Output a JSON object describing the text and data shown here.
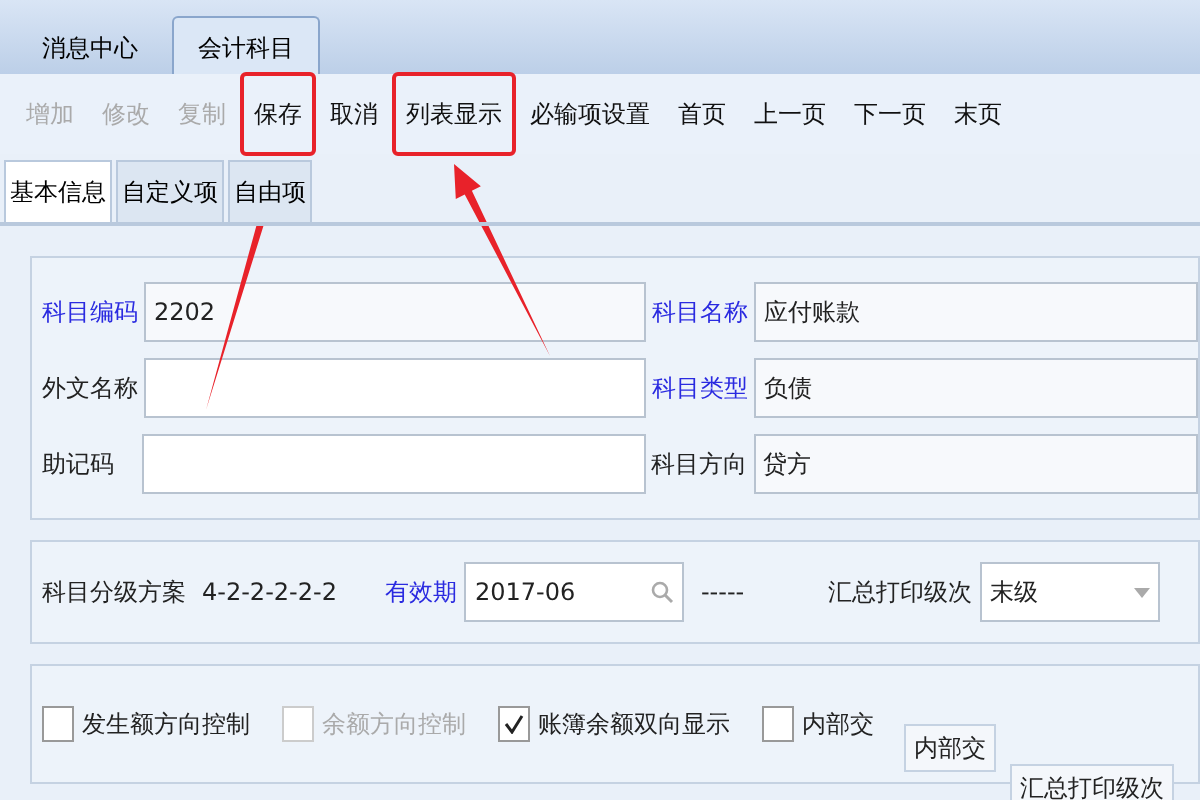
{
  "tabs": [
    {
      "label": "消息中心",
      "selected": false
    },
    {
      "label": "会计科目",
      "selected": true
    }
  ],
  "toolbar": [
    {
      "label": "增加",
      "disabled": true,
      "highlighted": false
    },
    {
      "label": "修改",
      "disabled": true,
      "highlighted": false
    },
    {
      "label": "复制",
      "disabled": true,
      "highlighted": false
    },
    {
      "label": "保存",
      "disabled": false,
      "highlighted": true
    },
    {
      "label": "取消",
      "disabled": false,
      "highlighted": false
    },
    {
      "label": "列表显示",
      "disabled": false,
      "highlighted": true
    },
    {
      "label": "必输项设置",
      "disabled": false,
      "highlighted": false
    },
    {
      "label": "首页",
      "disabled": false,
      "highlighted": false
    },
    {
      "label": "上一页",
      "disabled": false,
      "highlighted": false
    },
    {
      "label": "下一页",
      "disabled": false,
      "highlighted": false
    },
    {
      "label": "末页",
      "disabled": false,
      "highlighted": false
    }
  ],
  "subtabs": [
    {
      "label": "基本信息",
      "selected": true
    },
    {
      "label": "自定义项",
      "selected": false
    },
    {
      "label": "自由项",
      "selected": false
    }
  ],
  "fields": [
    {
      "label": "科目编码",
      "required": true,
      "value": "2202"
    },
    {
      "label": "科目名称",
      "required": true,
      "value": "应付账款"
    },
    {
      "label": "外文名称",
      "required": false
    },
    {
      "label": "科目类型",
      "required": true,
      "value": "负债"
    },
    {
      "label": "助记码",
      "required": false
    },
    {
      "label": "科目方向",
      "required": false,
      "value": "贷方"
    }
  ],
  "scheme": {
    "label": "科目分级方案",
    "value": "4-2-2-2-2-2"
  },
  "valid_period": {
    "label": "有效期",
    "value": "2017-06",
    "separator": "-----"
  },
  "print_level": {
    "label": "汇总打印级次",
    "value": "末级"
  },
  "checkboxes": [
    {
      "label": "发生额方向控制",
      "checked": false,
      "disabled": false
    },
    {
      "label": "余额方向控制",
      "checked": false,
      "disabled": true
    },
    {
      "label": "账簿余额双向显示",
      "checked": true,
      "disabled": false
    },
    {
      "label": "内部交",
      "checked": false,
      "disabled": false
    }
  ],
  "ghost_texts": [
    "内部交",
    "汇总打印级次"
  ]
}
